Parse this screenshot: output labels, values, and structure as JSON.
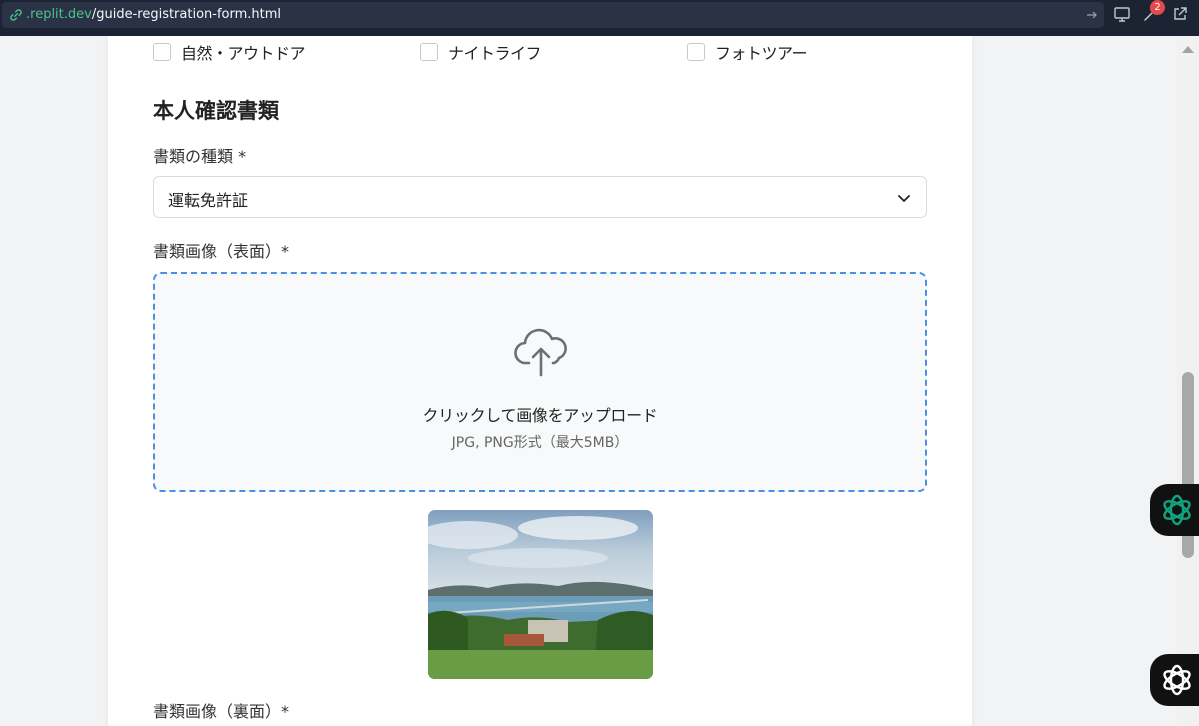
{
  "browser": {
    "url_domain": ".replit.dev",
    "url_path": "/guide-registration-form.html",
    "notification_count": "2"
  },
  "interests": [
    {
      "label": "自然・アウトドア",
      "checked": false
    },
    {
      "label": "ナイトライフ",
      "checked": false
    },
    {
      "label": "フォトツアー",
      "checked": false
    }
  ],
  "id_section": {
    "title": "本人確認書類",
    "doc_type_label": "書類の種類 *",
    "doc_type_value": "運転免許証",
    "front_label": "書類画像（表面）*",
    "upload_text": "クリックして画像をアップロード",
    "upload_hint": "JPG, PNG形式（最大5MB）",
    "back_label": "書類画像（裏面）*"
  },
  "colors": {
    "accent": "#4a90e2",
    "topbar": "#1c2333",
    "domain_green": "#4cc38a",
    "fab_green": "#10a37f"
  }
}
